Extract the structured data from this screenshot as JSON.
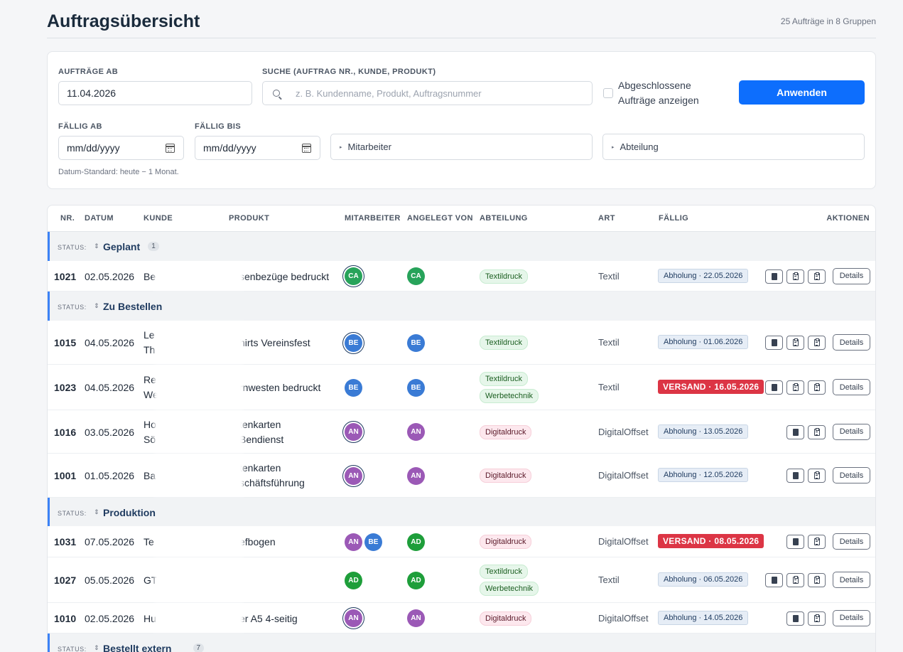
{
  "header": {
    "title": "Auftragsübersicht",
    "summary": "25 Aufträge in 8 Gruppen"
  },
  "filters": {
    "auftraege_ab_label": "AUFTRÄGE AB",
    "auftraege_ab_value": "11.04.2026",
    "search_label": "SUCHE (AUFTRAG NR., KUNDE, PRODUKT)",
    "search_placeholder": "z. B. Kundenname, Produkt, Auftragsnummer",
    "closed_label": "Abgeschlossene Aufträge anzeigen",
    "closed_label_line1": "Abgeschlossene",
    "closed_label_line2": "Aufträge anzeigen",
    "apply_label": "Anwenden",
    "faellig_ab_label": "FÄLLIG AB",
    "faellig_ab_value": "mm/dd/yyyy",
    "faellig_bis_label": "FÄLLIG BIS",
    "faellig_bis_value": "mm/dd/yyyy",
    "mitarbeiter_label": "Mitarbeiter",
    "abteilung_label": "Abteilung",
    "hint": "Datum-Standard: heute − 1 Monat."
  },
  "table": {
    "columns": [
      "NR.",
      "DATUM",
      "KUNDE",
      "PRODUKT",
      "MITARBEITER",
      "ANGELEGT VON",
      "ABTEILUNG",
      "ART",
      "FÄLLIG",
      "AKTIONEN"
    ],
    "status_prefix": "STATUS:",
    "sort_icon": "⇕",
    "details_label": "Details",
    "groups": [
      {
        "name": "Geplant",
        "count": "1"
      },
      {
        "name": "Zu Bestellen",
        "count": ""
      },
      {
        "name": "Produktion",
        "count": ""
      },
      {
        "name": "Bestellt extern",
        "count": "7"
      }
    ],
    "rows": [
      {
        "nr": "1021",
        "datum": "02.05.2026",
        "kunde1": "Be",
        "kunde2": "",
        "produkt1": "senbezüge bedruckt",
        "produkt2": "",
        "mitarbeiter": [
          "CA"
        ],
        "angelegt": "CA",
        "abteilung": [
          "Textildruck"
        ],
        "art": "Textil",
        "faellig": "Abholung · 22.05.2026",
        "faellig_type": "pick",
        "actions": 3
      },
      {
        "nr": "1015",
        "datum": "04.05.2026",
        "kunde1": "Le",
        "kunde2": "Th",
        "produkt1": "hirts Vereinsfest",
        "produkt2": "",
        "mitarbeiter": [
          "BE"
        ],
        "angelegt": "BE",
        "abteilung": [
          "Textildruck"
        ],
        "art": "Textil",
        "faellig": "Abholung · 01.06.2026",
        "faellig_type": "pick",
        "actions": 3
      },
      {
        "nr": "1023",
        "datum": "04.05.2026",
        "kunde1": "Re",
        "kunde2": "We",
        "produkt1": "rnwesten bedruckt",
        "produkt2": "",
        "mitarbeiter": [
          "BE"
        ],
        "angelegt": "BE",
        "abteilung": [
          "Textildruck",
          "Werbetechnik"
        ],
        "art": "Textil",
        "faellig": "VERSAND · 16.05.2026",
        "faellig_type": "ship",
        "actions": 3
      },
      {
        "nr": "1016",
        "datum": "03.05.2026",
        "kunde1": "Ho",
        "kunde2": "Sö",
        "produkt1": "tenkarten",
        "produkt2": "Bendienst",
        "mitarbeiter": [
          "AN"
        ],
        "angelegt": "AN",
        "abteilung": [
          "Digitaldruck"
        ],
        "art": "DigitalOffset",
        "faellig": "Abholung · 13.05.2026",
        "faellig_type": "pick",
        "actions": 2
      },
      {
        "nr": "1001",
        "datum": "01.05.2026",
        "kunde1": "Ba",
        "kunde2": "",
        "produkt1": "tenkarten",
        "produkt2": "schäftsführung",
        "mitarbeiter": [
          "AN"
        ],
        "angelegt": "AN",
        "abteilung": [
          "Digitaldruck"
        ],
        "art": "DigitalOffset",
        "faellig": "Abholung · 12.05.2026",
        "faellig_type": "pick",
        "actions": 2
      },
      {
        "nr": "1031",
        "datum": "07.05.2026",
        "kunde1": "Te",
        "kunde2": "",
        "produkt1": "efbogen",
        "produkt2": "",
        "mitarbeiter": [
          "AN",
          "BE"
        ],
        "angelegt": "AD",
        "abteilung": [
          "Digitaldruck"
        ],
        "art": "DigitalOffset",
        "faellig": "VERSAND · 08.05.2026",
        "faellig_type": "ship",
        "actions": 2
      },
      {
        "nr": "1027",
        "datum": "05.05.2026",
        "kunde1": "GT",
        "kunde2": "",
        "produkt1": "",
        "produkt2": "",
        "mitarbeiter": [
          "AD"
        ],
        "angelegt": "AD",
        "abteilung": [
          "Textildruck",
          "Werbetechnik"
        ],
        "art": "Textil",
        "faellig": "Abholung · 06.05.2026",
        "faellig_type": "pick",
        "actions": 3
      },
      {
        "nr": "1010",
        "datum": "02.05.2026",
        "kunde1": "Hu",
        "kunde2": "",
        "produkt1": "er A5 4-seitig",
        "produkt2": "",
        "mitarbeiter": [
          "AN"
        ],
        "angelegt": "AN",
        "abteilung": [
          "Digitaldruck"
        ],
        "art": "DigitalOffset",
        "faellig": "Abholung · 14.05.2026",
        "faellig_type": "pick",
        "actions": 2
      }
    ]
  },
  "colors": {
    "CA": "#27a35a",
    "BE": "#3a7bd5",
    "AN": "#9b59b6",
    "AD": "#1e9e3a",
    "primary": "#0d6efd",
    "ship": "#dc3545"
  }
}
